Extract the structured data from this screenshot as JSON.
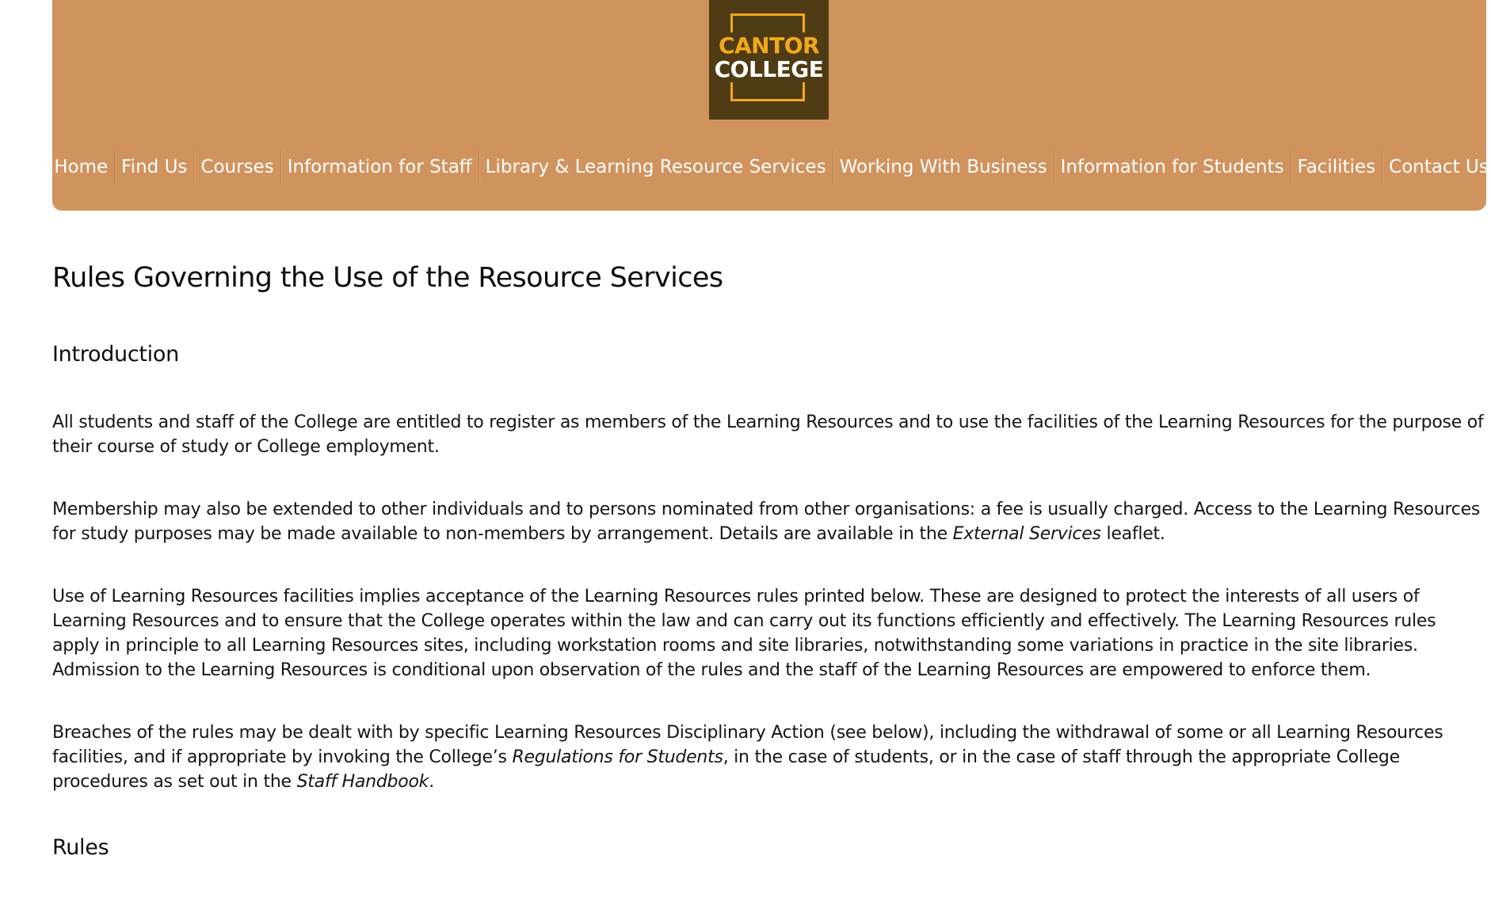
{
  "logo": {
    "line1": "CANTOR",
    "line2": "COLLEGE"
  },
  "nav": {
    "items": [
      {
        "label": "Home"
      },
      {
        "label": "Find Us"
      },
      {
        "label": "Courses"
      },
      {
        "label": "Information for Staff"
      },
      {
        "label": "Library & Learning Resource Services"
      },
      {
        "label": "Working With Business"
      },
      {
        "label": "Information for Students"
      },
      {
        "label": "Facilities"
      },
      {
        "label": "Contact Us"
      }
    ]
  },
  "main": {
    "page_title": "Rules Governing the Use of the Resource Services",
    "intro_heading": "Introduction",
    "para1": "All students and staff of the College are entitled to register as members of the Learning Resources and to use the facilities of the Learning Resources for the purpose of their course of study or College employment.",
    "para2": {
      "before": "Membership may also be extended to other individuals and to persons nominated from other organisations: a fee is usually charged. Access to the Learning Resources for study purposes may be made available to non-members by arrangement. Details are available in the ",
      "em": "External Services",
      "after": " leaflet."
    },
    "para3": "Use of Learning Resources facilities implies acceptance of the Learning Resources rules printed below. These are designed to protect the interests of all users of Learning Resources and to ensure that the College operates within the law and can carry out its functions efficiently and effectively. The Learning Resources rules apply in principle to all Learning Resources sites, including workstation rooms and site libraries, notwithstanding some variations in practice in the site libraries. Admission to the Learning Resources is conditional upon observation of the rules and the staff of the Learning Resources are empowered to enforce them.",
    "para4": {
      "before": "Breaches of the rules may be dealt with by specific Learning Resources Disciplinary Action (see below), including the withdrawal of some or all Learning Resources facilities, and if appropriate by invoking the College’s ",
      "em1": "Regulations for Students",
      "middle": ", in the case of students, or in the case of staff through the appropriate College procedures as set out in the ",
      "em2": "Staff Handbook",
      "after": "."
    },
    "rules_heading": "Rules"
  },
  "colors": {
    "header_bg": "#d1935e",
    "logo_bg": "#503c14",
    "logo_accent": "#f3a81c",
    "nav_text": "#ffffff",
    "body_text": "#151515"
  }
}
